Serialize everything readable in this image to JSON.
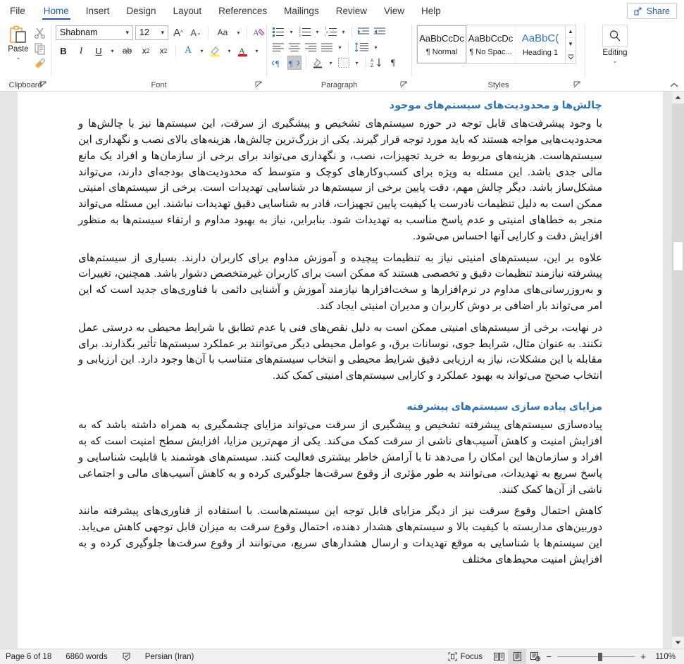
{
  "window": {
    "app": "Microsoft Word",
    "share_label": "Share",
    "share_icon": "share-person-icon"
  },
  "tabs": [
    {
      "label": "File",
      "active": false
    },
    {
      "label": "Home",
      "active": true
    },
    {
      "label": "Insert",
      "active": false
    },
    {
      "label": "Design",
      "active": false
    },
    {
      "label": "Layout",
      "active": false
    },
    {
      "label": "References",
      "active": false
    },
    {
      "label": "Mailings",
      "active": false
    },
    {
      "label": "Review",
      "active": false
    },
    {
      "label": "View",
      "active": false
    },
    {
      "label": "Help",
      "active": false
    }
  ],
  "ribbon": {
    "collapse_icon": "chevron-up-icon",
    "groups": {
      "clipboard": {
        "label": "Clipboard",
        "dialog_launcher": "dialog-launcher-icon",
        "paste_label": "Paste",
        "paste_caret": "⌄",
        "items": [
          "paste-icon",
          "cut-scissors-icon",
          "copy-icon",
          "format-painter-icon"
        ]
      },
      "font": {
        "label": "Font",
        "dialog_launcher": "dialog-launcher-icon",
        "font_name": "Shabnam",
        "font_size": "12",
        "grow_font": "A",
        "shrink_font": "A",
        "change_case": "Aa",
        "clear_formatting": "A",
        "bold": "B",
        "italic": "I",
        "underline": "U",
        "strikethrough": "ab",
        "subscript": "x",
        "subscript_sub": "2",
        "superscript": "x",
        "superscript_sup": "2",
        "text_effects": "A",
        "highlight": "A",
        "font_color": "A",
        "caret": "⌄"
      },
      "paragraph": {
        "label": "Paragraph",
        "dialog_launcher": "dialog-launcher-icon",
        "buttons": [
          "bullets-icon",
          "numbering-icon",
          "multilevel-list-icon",
          "decrease-indent-icon",
          "increase-indent-icon",
          "align-left-icon",
          "align-center-icon",
          "align-right-icon",
          "justify-icon",
          "line-spacing-icon",
          "ltr-text-direction-icon",
          "rtl-text-direction-icon",
          "shading-icon",
          "borders-icon",
          "sort-icon",
          "show-formatting-marks-icon"
        ]
      },
      "styles": {
        "label": "Styles",
        "dialog_launcher": "dialog-launcher-icon",
        "items": [
          {
            "preview": "AaBbCcDc",
            "name": "¶ Normal",
            "selected": true,
            "heading": false
          },
          {
            "preview": "AaBbCcDc",
            "name": "¶ No Spac...",
            "selected": false,
            "heading": false
          },
          {
            "preview": "AaBbC(",
            "name": "Heading 1",
            "selected": false,
            "heading": true
          }
        ],
        "scroll_up": "▲",
        "scroll_down": "▼",
        "more": "☰"
      },
      "editing": {
        "label": "Editing",
        "icon": "search-magnifier-icon",
        "caret": "⌄"
      }
    }
  },
  "document": {
    "sections": [
      {
        "type": "heading",
        "text": "چالش‌ها و محدودیت‌های سیستم‌های موجود"
      },
      {
        "type": "paragraph",
        "text": "با وجود پیشرفت‌های قابل توجه در حوزه سیستم‌های تشخیص و پیشگیری از سرقت، این سیستم‌ها نیز با چالش‌ها و محدودیت‌هایی مواجه هستند که باید مورد توجه قرار گیرند. یکی از بزرگ‌ترین چالش‌ها، هزینه‌های بالای نصب و نگهداری این سیستم‌هاست. هزینه‌های مربوط به خرید تجهیزات، نصب، و نگهداری می‌تواند برای برخی از سازمان‌ها و افراد یک مانع مالی جدی باشد. این مسئله به ویژه برای کسب‌وکارهای کوچک و متوسط که محدودیت‌های بودجه‌ای دارند، می‌تواند مشکل‌ساز باشد. دیگر چالش مهم، دقت پایین برخی از سیستم‌ها در شناسایی تهدیدات است. برخی از سیستم‌های امنیتی ممکن است به دلیل تنظیمات نادرست یا کیفیت پایین تجهیزات، قادر به شناسایی دقیق تهدیدات نباشند. این مسئله می‌تواند منجر به خطاهای امنیتی و عدم پاسخ مناسب به تهدیدات شود. بنابراین، نیاز به بهبود مداوم و ارتقاء سیستم‌ها به منظور افزایش دقت و کارایی آنها احساس می‌شود."
      },
      {
        "type": "paragraph",
        "text": "علاوه بر این، سیستم‌های امنیتی نیاز به تنظیمات پیچیده و آموزش مداوم برای کاربران دارند. بسیاری از سیستم‌های پیشرفته نیازمند تنظیمات دقیق و تخصصی هستند که ممکن است برای کاربران غیرمتخصص دشوار باشد. همچنین، تغییرات و به‌روزرسانی‌های مداوم در نرم‌افزارها و سخت‌افزارها نیازمند آموزش و آشنایی دائمی با فناوری‌های جدید است که این امر می‌تواند بار اضافی بر دوش کاربران و مدیران امنیتی ایجاد کند."
      },
      {
        "type": "paragraph",
        "text": "در نهایت، برخی از سیستم‌های امنیتی ممکن است به دلیل نقص‌های فنی یا عدم تطابق با شرایط محیطی به درستی عمل نکنند. به عنوان مثال، شرایط جوی، نوسانات برق، و عوامل محیطی دیگر می‌توانند بر عملکرد سیستم‌ها تأثیر بگذارند. برای مقابله با این مشکلات، نیاز به ارزیابی دقیق شرایط محیطی و انتخاب سیستم‌های متناسب با آن‌ها وجود دارد. این ارزیابی و انتخاب صحیح می‌تواند به بهبود عملکرد و کارایی سیستم‌های امنیتی کمک کند."
      },
      {
        "type": "heading",
        "text": "مزایای پیاده سازی سیستم‌های پیشرفته"
      },
      {
        "type": "paragraph",
        "text": "پیاده‌سازی سیستم‌های پیشرفته تشخیص و پیشگیری از سرقت می‌تواند مزایای چشمگیری به همراه داشته باشد که به افزایش امنیت و کاهش آسیب‌های ناشی از سرقت کمک می‌کند. یکی از مهم‌ترین مزایا، افزایش سطح امنیت است که به افراد و سازمان‌ها این امکان را می‌دهد تا با آرامش خاطر بیشتری فعالیت کنند. سیستم‌های هوشمند با قابلیت شناسایی و پاسخ سریع به تهدیدات، می‌توانند به طور مؤثری از وقوع سرقت‌ها جلوگیری کرده و به کاهش آسیب‌های مالی و اجتماعی ناشی از آن‌ها کمک کنند."
      },
      {
        "type": "paragraph",
        "text": "کاهش احتمال وقوع سرقت نیز از دیگر مزایای قابل توجه این سیستم‌هاست. با استفاده از فناوری‌های پیشرفته مانند دوربین‌های مداربسته با کیفیت بالا و سیستم‌های هشدار دهنده، احتمال وقوع سرقت به میزان قابل توجهی کاهش می‌یابد. این سیستم‌ها با شناسایی به موقع تهدیدات و ارسال هشدارهای سریع، می‌توانند از وقوع سرقت‌ها جلوگیری کرده و به افزایش امنیت محیط‌های مختلف"
      }
    ]
  },
  "statusbar": {
    "page": "Page 6 of 18",
    "words": "6860 words",
    "proofing_icon": "proofing-errors-icon",
    "language": "Persian (Iran)",
    "focus_label": "Focus",
    "focus_icon": "focus-mode-icon",
    "views": [
      {
        "name": "read-mode-view-button",
        "active": false
      },
      {
        "name": "print-layout-view-button",
        "active": true
      },
      {
        "name": "web-layout-view-button",
        "active": false
      }
    ],
    "zoom_out": "−",
    "zoom_in": "+",
    "zoom_value": "110%"
  },
  "colors": {
    "accent": "#2b579a",
    "heading": "#2e74b5",
    "ribbon_bg": "#ffffff",
    "status_bg": "#f0f0f0",
    "page_bg": "#e6e6e6"
  }
}
